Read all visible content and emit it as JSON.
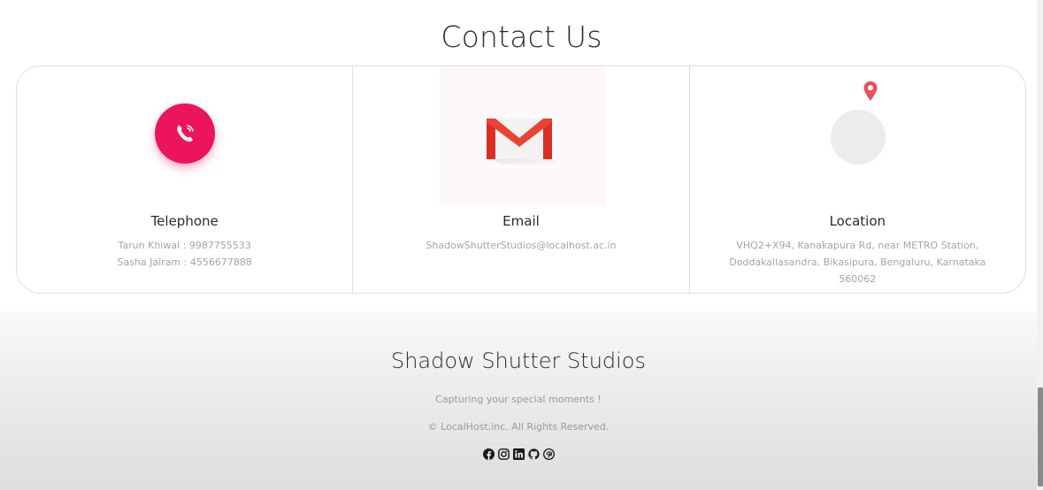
{
  "contact": {
    "heading": "Contact Us",
    "telephone": {
      "title": "Telephone",
      "lines": [
        "Tarun Khiwal : 9987755533",
        "Sasha Jairam : 4556677888"
      ],
      "icon": "phone-icon",
      "color": "#ec145b"
    },
    "email": {
      "title": "Email",
      "lines": [
        "ShadowShutterStudios@localhost.ac.in"
      ],
      "icon": "gmail-icon",
      "color": "#d93025"
    },
    "location": {
      "title": "Location",
      "lines": [
        "VHQ2+X94, Kanakapura Rd, near METRO Station,",
        "Doddakallasandra, Bikasipura, Bengaluru, Karnataka",
        "560062"
      ],
      "icon": "map-pin-icon",
      "color": "#ea4f5c"
    }
  },
  "footer": {
    "title": "Shadow Shutter Studios",
    "tagline": "Capturing your special moments !",
    "copyright": "© LocalHost,inc. All Rights Reserved.",
    "social": [
      "facebook-icon",
      "instagram-icon",
      "linkedin-icon",
      "github-icon",
      "pinterest-icon"
    ]
  }
}
